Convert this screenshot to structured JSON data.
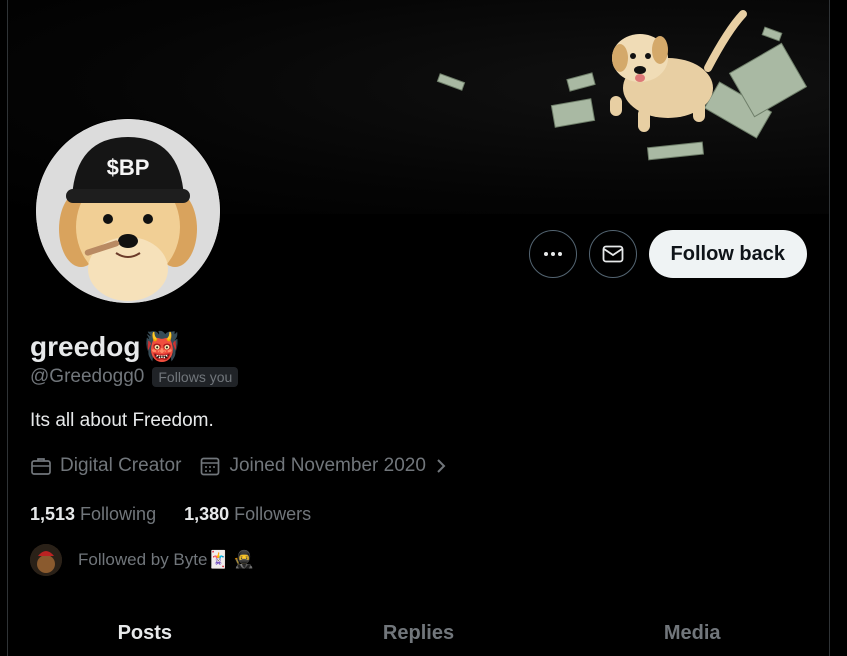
{
  "profile": {
    "display_name": "greedog",
    "name_emoji": "👹",
    "handle": "@Greedogg0",
    "follows_you": "Follows you",
    "bio": "Its all about Freedom.",
    "category": "Digital Creator",
    "joined": "Joined November 2020",
    "avatar_cap_text": "$BP"
  },
  "actions": {
    "more_icon": "more-horizontal-icon",
    "message_icon": "envelope-icon",
    "follow_label": "Follow back"
  },
  "stats": {
    "following_count": "1,513",
    "following_label": "Following",
    "followers_count": "1,380",
    "followers_label": "Followers"
  },
  "followed_by": {
    "text": "Followed by Byte",
    "emojis": "🃏 🥷"
  },
  "tabs": [
    {
      "label": "Posts"
    },
    {
      "label": "Replies"
    },
    {
      "label": "Media"
    }
  ],
  "colors": {
    "background": "#000000",
    "text_primary": "#e7e9ea",
    "text_secondary": "#71767b",
    "button_light": "#eff3f4"
  }
}
